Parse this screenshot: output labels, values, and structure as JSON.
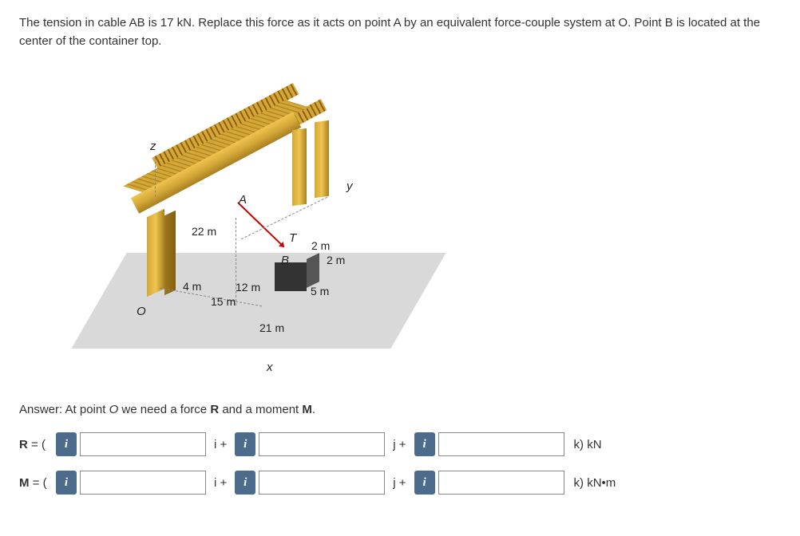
{
  "problem": {
    "text": "The tension in cable AB is 17 kN. Replace this force as it acts on point A by an equivalent force-couple system at O. Point B is located at the center of the container top."
  },
  "figure": {
    "labels": {
      "A": "A",
      "B": "B",
      "T": "T",
      "O": "O",
      "x": "x",
      "y": "y",
      "z": "z"
    },
    "dims": {
      "d22": "22 m",
      "d4": "4 m",
      "d12": "12 m",
      "d15": "15 m",
      "d21": "21 m",
      "d2a": "2 m",
      "d2b": "2 m",
      "d5": "5 m"
    }
  },
  "answer": {
    "prompt_prefix": "Answer: At point ",
    "prompt_O": "O",
    "prompt_mid": " we need a force ",
    "prompt_R": "R",
    "prompt_mid2": " and a moment ",
    "prompt_M": "M",
    "prompt_end": ".",
    "R_label": "R = (",
    "M_label": "M = (",
    "i_plus": "i +",
    "j_plus": "j +",
    "R_unit": "k) kN",
    "M_unit": "k) kN•m"
  }
}
